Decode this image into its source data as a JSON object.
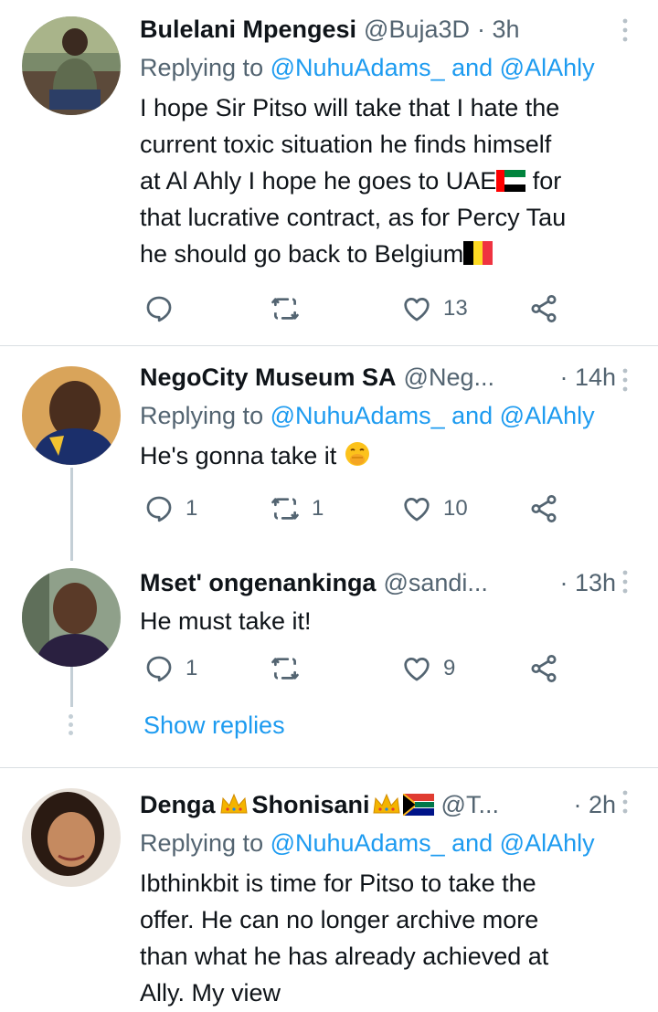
{
  "tweets": [
    {
      "name": "Bulelani Mpengesi",
      "handle": "@Buja3D",
      "time": "· 3h",
      "replying_prefix": "Replying to ",
      "replying_user1": "@NuhuAdams_",
      "replying_and": " and ",
      "replying_user2": "@AlAhly",
      "text_l1": "I hope Sir Pitso will take that I hate the",
      "text_l2": "current toxic situation he finds himself",
      "text_l3a": "at Al Ahly I hope he goes to UAE",
      "text_l3b": " for",
      "text_l4": "that lucrative contract, as for Percy Tau",
      "text_l5": "he should go back to Belgium",
      "replies": "",
      "retweets": "",
      "likes": "13"
    },
    {
      "name": "NegoCity Museum SA",
      "handle": "@Neg...",
      "time": "· 14h",
      "replying_prefix": "Replying to ",
      "replying_user1": "@NuhuAdams_",
      "replying_and": " and ",
      "replying_user2": "@AlAhly",
      "text": "He's gonna take it",
      "replies": "1",
      "retweets": "1",
      "likes": "10"
    },
    {
      "name": "Mset' ongenankinga",
      "handle": "@sandi...",
      "time": "· 13h",
      "text": "He must take it!",
      "replies": "1",
      "retweets": "",
      "likes": "9"
    },
    {
      "name_a": "Denga",
      "name_b": "Shonisani",
      "handle": "@T...",
      "time": "· 2h",
      "replying_prefix": "Replying to ",
      "replying_user1": "@NuhuAdams_",
      "replying_and": " and ",
      "replying_user2": "@AlAhly",
      "text_l1": "Ibthinkbit is time for Pitso to take the",
      "text_l2": "offer. He can no longer archive more",
      "text_l3": "than what he has already achieved at",
      "text_l4": "Ally. My view"
    }
  ],
  "show_replies": "Show replies",
  "colors": {
    "link": "#1d9bf0",
    "secondary": "#536471",
    "text": "#0f1419",
    "divider": "#dadfe3",
    "thread_line": "#c4cfd6"
  },
  "icons": [
    "reply-icon",
    "retweet-icon",
    "like-icon",
    "share-icon",
    "more-icon",
    "uae-flag-icon",
    "belgium-flag-icon",
    "south-africa-flag-icon",
    "crown-icon",
    "face-with-hand-over-mouth-icon"
  ]
}
